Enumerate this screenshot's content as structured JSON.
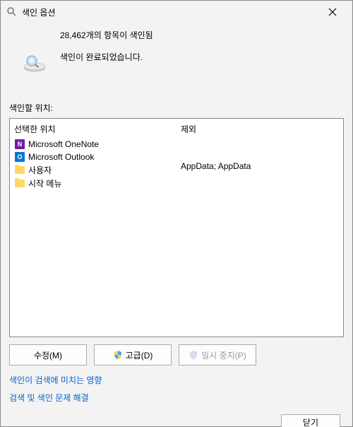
{
  "window": {
    "title": "색인 옵션"
  },
  "status": {
    "count_text": "28,462개의 항목이 색인됨",
    "complete_text": "색인이 완료되었습니다."
  },
  "section_label": "색인할 위치:",
  "columns": {
    "selected_header": "선택한 위치",
    "exclude_header": "제외"
  },
  "locations": [
    {
      "icon": "onenote",
      "label": "Microsoft OneNote",
      "exclude": ""
    },
    {
      "icon": "outlook",
      "label": "Microsoft Outlook",
      "exclude": ""
    },
    {
      "icon": "folder",
      "label": "사용자",
      "exclude": "AppData; AppData"
    },
    {
      "icon": "folder",
      "label": "시작 메뉴",
      "exclude": ""
    }
  ],
  "buttons": {
    "modify": "수정(M)",
    "advanced": "고급(D)",
    "pause": "일시 중지(P)",
    "close": "닫기"
  },
  "links": {
    "impact": "색인이 검색에 미치는 영향",
    "troubleshoot": "검색 및 색인 문제 해결"
  }
}
